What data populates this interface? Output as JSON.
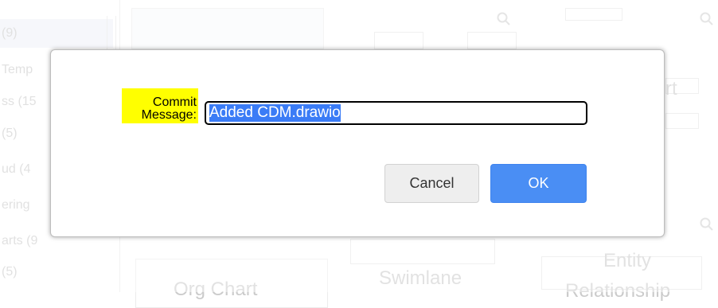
{
  "background": {
    "categories": [
      {
        "label": "(9)"
      },
      {
        "label": "Temp"
      },
      {
        "label": "ss (15"
      },
      {
        "label": "(5)"
      },
      {
        "label": "ud (4"
      },
      {
        "label": "ering"
      },
      {
        "label": "arts (9"
      },
      {
        "label": "(5)"
      }
    ],
    "tiles": [
      {
        "label": "Org Chart"
      },
      {
        "label": "Swimlane"
      },
      {
        "label": "Entity"
      },
      {
        "label": "Relationship"
      },
      {
        "label": "rt"
      }
    ]
  },
  "dialog": {
    "field_label": "Commit Message:",
    "input_value": "Added CDM.drawio",
    "cancel_label": "Cancel",
    "ok_label": "OK"
  },
  "colors": {
    "label_highlight": "#ffff00",
    "ok_button": "#4a8ef4",
    "selection": "#3b7cf6"
  }
}
